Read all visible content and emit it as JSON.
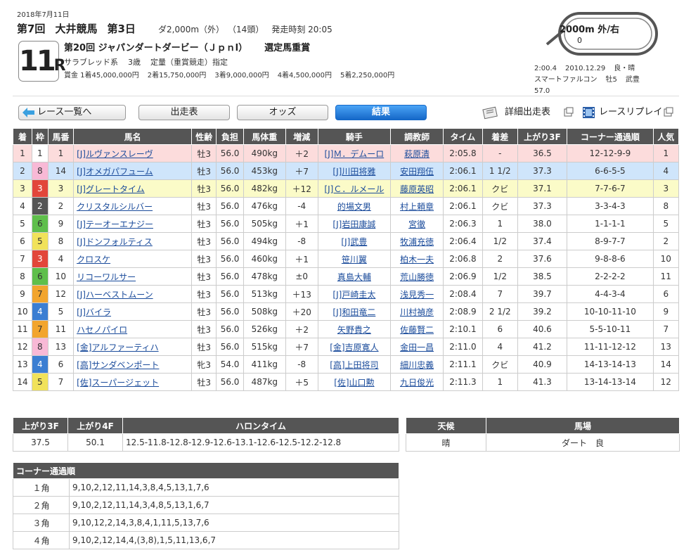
{
  "header": {
    "date": "2018年7月11日",
    "meeting": [
      "第7回",
      "大井競馬",
      "第3日"
    ],
    "conditions": [
      "ダ2,000m（外）",
      "（14頭）",
      "発走時刻 20:05"
    ],
    "race_number": "11",
    "race_suffix": "R",
    "race_name": "第20回 ジャパンダートダービー（Ｊｐｎl）",
    "grade_text": "選定馬重賞",
    "race_class": [
      "サラブレッド系",
      "3歳",
      "定量（重賞競走）指定"
    ],
    "prizes": [
      "賞金 1着45,000,000円",
      "2着15,750,000円",
      "3着9,000,000円",
      "4着4,500,000円",
      "5着2,250,000円"
    ],
    "course_label": "2000m  外/右",
    "course_start_marker": "0",
    "record": {
      "line1": [
        "2:00.4",
        "2010.12.29",
        "良・晴"
      ],
      "line2": [
        "スマートファルコン",
        "牡5",
        "武豊"
      ],
      "line3": "57.0"
    }
  },
  "buttons": {
    "back": "レース一覧へ",
    "entries": "出走表",
    "odds": "オッズ",
    "result": "結果",
    "detail": "詳細出走表",
    "replay": "レースリプレイ"
  },
  "results": {
    "headers": [
      "着",
      "枠",
      "馬番",
      "馬名",
      "性齢",
      "負担",
      "馬体重",
      "増減",
      "騎手",
      "調教師",
      "タイム",
      "着差",
      "上がり3F",
      "コーナー通過順",
      "人気"
    ],
    "rows": [
      {
        "pos": "1",
        "waku": "1",
        "num": "1",
        "name": "[J]ルヴァンスレーヴ",
        "sex": "牡3",
        "wt": "56.0",
        "bw": "490kg",
        "diff": "＋2",
        "jockey": "[J]Ｍ．デムーロ",
        "trainer": "萩原清",
        "time": "2:05.8",
        "margin": "-",
        "f3": "36.5",
        "corner": "12-12-9-9",
        "pop": "1"
      },
      {
        "pos": "2",
        "waku": "8",
        "num": "14",
        "name": "[J]オメガパフューム",
        "sex": "牡3",
        "wt": "56.0",
        "bw": "453kg",
        "diff": "＋7",
        "jockey": "[J]川田将雅",
        "trainer": "安田翔伍",
        "time": "2:06.1",
        "margin": "1 1/2",
        "f3": "37.3",
        "corner": "6-6-5-5",
        "pop": "4"
      },
      {
        "pos": "3",
        "waku": "3",
        "num": "3",
        "name": "[J]グレートタイム",
        "sex": "牡3",
        "wt": "56.0",
        "bw": "482kg",
        "diff": "＋12",
        "jockey": "[J]Ｃ．ルメール",
        "trainer": "藤原英昭",
        "time": "2:06.1",
        "margin": "クビ",
        "f3": "37.1",
        "corner": "7-7-6-7",
        "pop": "3"
      },
      {
        "pos": "4",
        "waku": "2",
        "num": "2",
        "name": "クリスタルシルバー",
        "sex": "牡3",
        "wt": "56.0",
        "bw": "476kg",
        "diff": "-4",
        "jockey": "的場文男",
        "trainer": "村上頼章",
        "time": "2:06.1",
        "margin": "クビ",
        "f3": "37.3",
        "corner": "3-3-4-3",
        "pop": "8"
      },
      {
        "pos": "5",
        "waku": "6",
        "num": "9",
        "name": "[J]テーオーエナジー",
        "sex": "牡3",
        "wt": "56.0",
        "bw": "505kg",
        "diff": "＋1",
        "jockey": "[J]岩田康誠",
        "trainer": "宮徹",
        "time": "2:06.3",
        "margin": "1",
        "f3": "38.0",
        "corner": "1-1-1-1",
        "pop": "5"
      },
      {
        "pos": "6",
        "waku": "5",
        "num": "8",
        "name": "[J]ドンフォルティス",
        "sex": "牡3",
        "wt": "56.0",
        "bw": "494kg",
        "diff": "-8",
        "jockey": "[J]武豊",
        "trainer": "牧浦充徳",
        "time": "2:06.4",
        "margin": "1/2",
        "f3": "37.4",
        "corner": "8-9-7-7",
        "pop": "2"
      },
      {
        "pos": "7",
        "waku": "3",
        "num": "4",
        "name": "クロスケ",
        "sex": "牡3",
        "wt": "56.0",
        "bw": "460kg",
        "diff": "＋1",
        "jockey": "笹川翼",
        "trainer": "柏木一夫",
        "time": "2:06.8",
        "margin": "2",
        "f3": "37.6",
        "corner": "9-8-8-6",
        "pop": "10"
      },
      {
        "pos": "8",
        "waku": "6",
        "num": "10",
        "name": "リコーワルサー",
        "sex": "牡3",
        "wt": "56.0",
        "bw": "478kg",
        "diff": "±0",
        "jockey": "真島大輔",
        "trainer": "荒山勝徳",
        "time": "2:06.9",
        "margin": "1/2",
        "f3": "38.5",
        "corner": "2-2-2-2",
        "pop": "11"
      },
      {
        "pos": "9",
        "waku": "7",
        "num": "12",
        "name": "[J]ハーベストムーン",
        "sex": "牡3",
        "wt": "56.0",
        "bw": "513kg",
        "diff": "＋13",
        "jockey": "[J]戸崎圭太",
        "trainer": "浅見秀一",
        "time": "2:08.4",
        "margin": "7",
        "f3": "39.7",
        "corner": "4-4-3-4",
        "pop": "6"
      },
      {
        "pos": "10",
        "waku": "4",
        "num": "5",
        "name": "[J]バイラ",
        "sex": "牡3",
        "wt": "56.0",
        "bw": "508kg",
        "diff": "＋20",
        "jockey": "[J]和田竜二",
        "trainer": "川村禎彦",
        "time": "2:08.9",
        "margin": "2 1/2",
        "f3": "39.2",
        "corner": "10-10-11-10",
        "pop": "9"
      },
      {
        "pos": "11",
        "waku": "7",
        "num": "11",
        "name": "ハセノパイロ",
        "sex": "牡3",
        "wt": "56.0",
        "bw": "526kg",
        "diff": "＋2",
        "jockey": "矢野貴之",
        "trainer": "佐藤賢二",
        "time": "2:10.1",
        "margin": "6",
        "f3": "40.6",
        "corner": "5-5-10-11",
        "pop": "7"
      },
      {
        "pos": "12",
        "waku": "8",
        "num": "13",
        "name": "[金]アルファーティハ",
        "sex": "牡3",
        "wt": "56.0",
        "bw": "515kg",
        "diff": "＋7",
        "jockey": "[金]吉原寛人",
        "trainer": "金田一昌",
        "time": "2:11.0",
        "margin": "4",
        "f3": "41.2",
        "corner": "11-11-12-12",
        "pop": "13"
      },
      {
        "pos": "13",
        "waku": "4",
        "num": "6",
        "name": "[高]サンダベンポート",
        "sex": "牝3",
        "wt": "54.0",
        "bw": "411kg",
        "diff": "-8",
        "jockey": "[高]上田将司",
        "trainer": "細川忠義",
        "time": "2:11.1",
        "margin": "クビ",
        "f3": "40.9",
        "corner": "14-13-14-13",
        "pop": "14"
      },
      {
        "pos": "14",
        "waku": "5",
        "num": "7",
        "name": "[佐]スーパージェット",
        "sex": "牡3",
        "wt": "56.0",
        "bw": "487kg",
        "diff": "＋5",
        "jockey": "[佐]山口勲",
        "trainer": "九日俊光",
        "time": "2:11.3",
        "margin": "1",
        "f3": "41.3",
        "corner": "13-14-13-14",
        "pop": "12"
      }
    ]
  },
  "waku_colors": {
    "1": {
      "bg": "#ffffff",
      "fg": "#333333"
    },
    "2": {
      "bg": "#555555",
      "fg": "#ffffff"
    },
    "3": {
      "bg": "#e2463a",
      "fg": "#ffffff"
    },
    "4": {
      "bg": "#3b7ed2",
      "fg": "#ffffff"
    },
    "5": {
      "bg": "#f1e25a",
      "fg": "#333333"
    },
    "6": {
      "bg": "#5fbf4b",
      "fg": "#333333"
    },
    "7": {
      "bg": "#f2a52e",
      "fg": "#333333"
    },
    "8": {
      "bg": "#f8b9d6",
      "fg": "#333333"
    }
  },
  "lap": {
    "headers": [
      "上がり3F",
      "上がり4F",
      "ハロンタイム"
    ],
    "values": [
      "37.5",
      "50.1",
      "12.5-11.8-12.8-12.9-12.6-13.1-12.6-12.5-12.2-12.8"
    ]
  },
  "weather": {
    "headers": [
      "天候",
      "馬場"
    ],
    "values": [
      "晴",
      "ダート　良"
    ]
  },
  "corners": {
    "header": "コーナー通過順",
    "rows": [
      {
        "label": "１角",
        "order": "9,10,2,12,11,14,3,8,4,5,13,1,7,6"
      },
      {
        "label": "２角",
        "order": "9,10,2,12,11,14,3,4,8,5,13,1,6,7"
      },
      {
        "label": "３角",
        "order": "9,10,12,2,14,3,8,4,1,11,5,13,7,6"
      },
      {
        "label": "４角",
        "order": "9,10,2,12,14,4,(3,8),1,5,11,13,6,7"
      }
    ]
  }
}
